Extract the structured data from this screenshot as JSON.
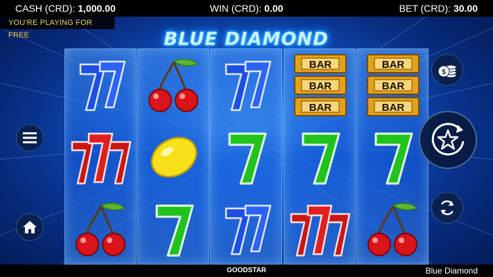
{
  "topbar": {
    "cash_label": "CASH (CRD):",
    "cash_value": "1,000.00",
    "win_label": "WIN (CRD):",
    "win_value": "0.00",
    "bet_label": "BET (CRD):",
    "bet_value": "30.00"
  },
  "free_play_notice": "YOU'RE PLAYING FOR FREE",
  "logo_text": "BLUE DIAMOND",
  "reels": [
    [
      "seven-blue",
      "seven-red-triple",
      "cherry"
    ],
    [
      "cherry",
      "lemon",
      "seven-green"
    ],
    [
      "seven-blue",
      "seven-green",
      "seven-blue"
    ],
    [
      "bar-triple",
      "seven-green",
      "seven-red-triple"
    ],
    [
      "bar-triple",
      "seven-green",
      "cherry"
    ]
  ],
  "bar_label": "BAR",
  "buttons": {
    "menu": "menu-icon",
    "home": "home-icon",
    "bet": "coins-icon",
    "spin": "star-spin-icon",
    "autoplay": "refresh-icon"
  },
  "footer": {
    "brand": "GOODSTAR",
    "game_name": "Blue Diamond"
  },
  "colors": {
    "background": "#0b3fa8",
    "notice_text": "#f0d24a",
    "seven_blue": "#1f4fe0",
    "seven_red": "#e0201e",
    "seven_green": "#22c21e",
    "bar_gold": "#e2a21a"
  }
}
